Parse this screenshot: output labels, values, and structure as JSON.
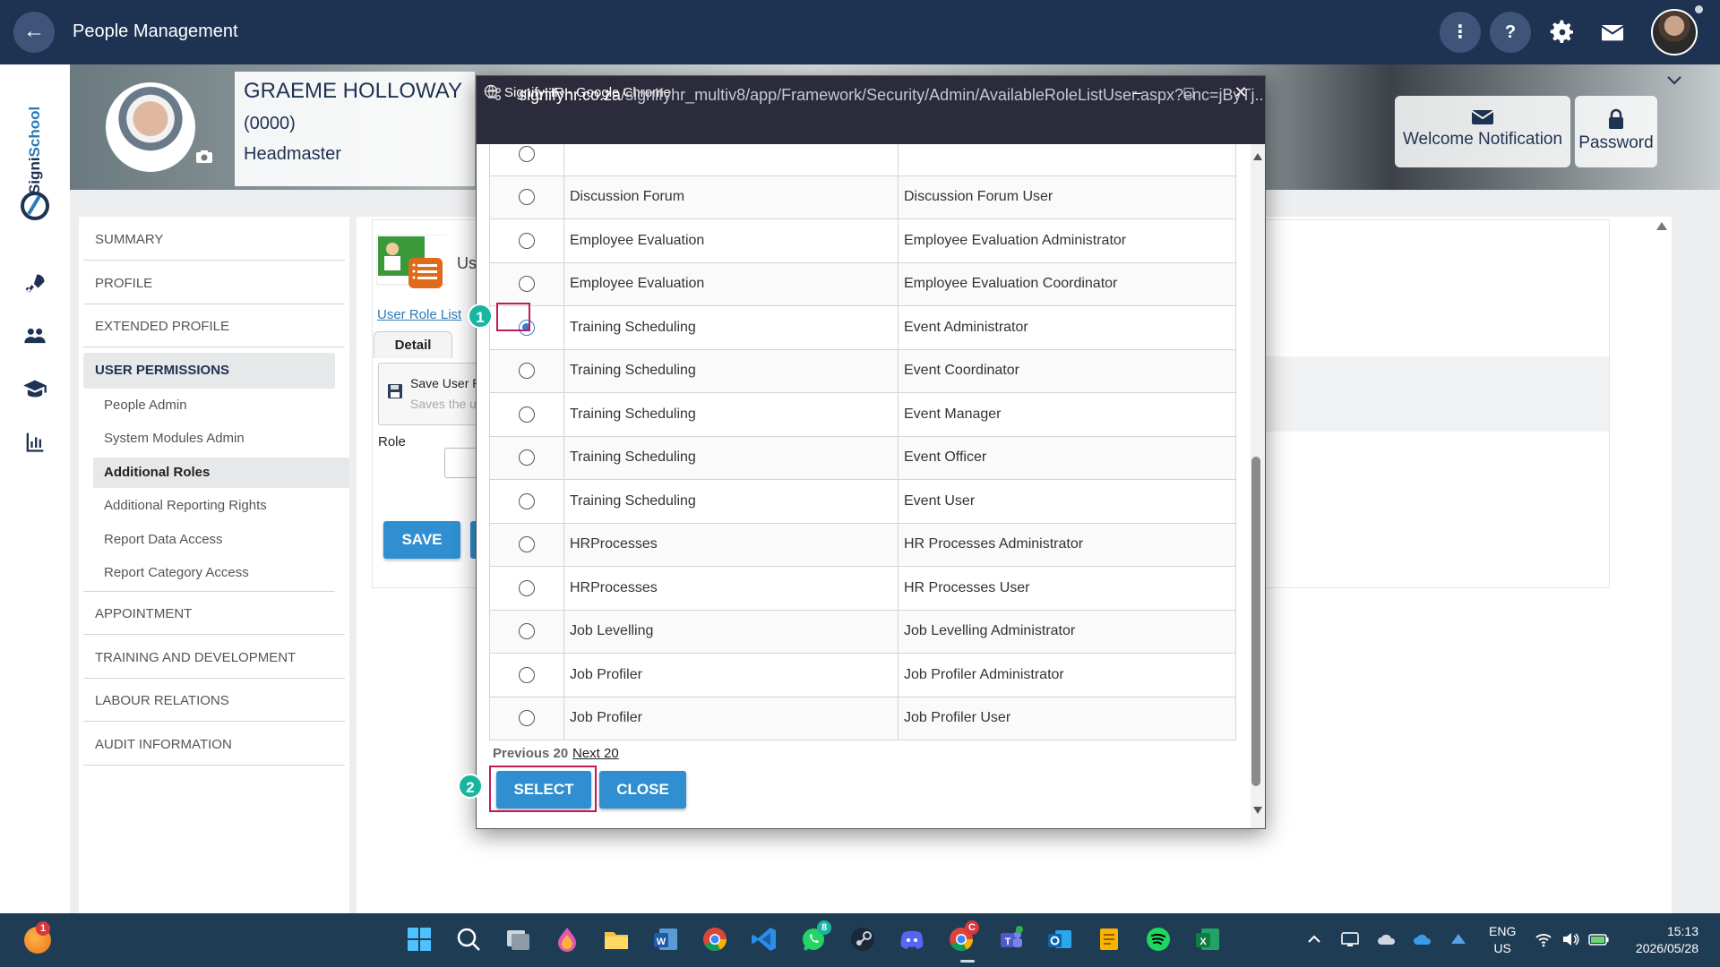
{
  "app": {
    "title": "People Management"
  },
  "topbar_icons": [
    "arrow-left-icon",
    "more-vertical-icon",
    "help-icon",
    "gear-icon",
    "mail-icon"
  ],
  "employee": {
    "name": "GRAEME HOLLOWAY",
    "code": "(0000)",
    "title": "Headmaster"
  },
  "banner_buttons": [
    {
      "label": "Welcome Notification",
      "icon": "envelope-icon"
    },
    {
      "label": "Password",
      "icon": "lock-icon"
    }
  ],
  "brand": {
    "logo_text": "SigniSchool"
  },
  "nav": {
    "summary": "SUMMARY",
    "profile": "PROFILE",
    "extended_profile": "EXTENDED PROFILE",
    "user_permissions": "USER PERMISSIONS",
    "sub_items": [
      "People Admin",
      "System Modules Admin",
      "Additional Roles",
      "Additional Reporting Rights",
      "Report Data Access",
      "Report Category Access"
    ],
    "appointment": "APPOINTMENT",
    "training": "TRAINING AND DEVELOPMENT",
    "labour": "LABOUR RELATIONS",
    "audit": "AUDIT INFORMATION"
  },
  "main": {
    "module_title": "Us",
    "role_list_link": "User Role List",
    "detail_tab": "Detail",
    "save_box_title": "Save User R",
    "save_box_subtitle": "Saves the u",
    "role_label": "Role",
    "save_button": "SAVE"
  },
  "popup": {
    "window_title": "SignifyHR - Google Chrome",
    "url_host": "signifyhr.co.za",
    "url_path": "/signifyhr_multiv8/app/Framework/Security/Admin/AvailableRoleListUser.aspx?enc=jByTj...",
    "rows": [
      {
        "module": "",
        "role": "",
        "checked": false
      },
      {
        "module": "Discussion Forum",
        "role": "Discussion Forum User",
        "checked": false
      },
      {
        "module": "Employee Evaluation",
        "role": "Employee Evaluation Administrator",
        "checked": false
      },
      {
        "module": "Employee Evaluation",
        "role": "Employee Evaluation Coordinator",
        "checked": false
      },
      {
        "module": "Training Scheduling",
        "role": "Event Administrator",
        "checked": true
      },
      {
        "module": "Training Scheduling",
        "role": "Event Coordinator",
        "checked": false
      },
      {
        "module": "Training Scheduling",
        "role": "Event Manager",
        "checked": false
      },
      {
        "module": "Training Scheduling",
        "role": "Event Officer",
        "checked": false
      },
      {
        "module": "Training Scheduling",
        "role": "Event User",
        "checked": false
      },
      {
        "module": "HRProcesses",
        "role": "HR Processes Administrator",
        "checked": false
      },
      {
        "module": "HRProcesses",
        "role": "HR Processes User",
        "checked": false
      },
      {
        "module": "Job Levelling",
        "role": "Job Levelling Administrator",
        "checked": false
      },
      {
        "module": "Job Profiler",
        "role": "Job Profiler Administrator",
        "checked": false
      },
      {
        "module": "Job Profiler",
        "role": "Job Profiler User",
        "checked": false
      }
    ],
    "prev_label": "Previous 20",
    "next_label": "Next 20",
    "select_button": "SELECT",
    "close_button": "CLOSE"
  },
  "annotations": {
    "step1": "1",
    "step2": "2"
  },
  "taskbar": {
    "apps": [
      "start-icon",
      "search-icon",
      "task-view-icon",
      "paint-icon",
      "file-explorer-icon",
      "word-icon",
      "chrome-icon",
      "vscode-icon",
      "whatsapp-icon",
      "steam-icon",
      "discord-icon",
      "chrome-profile-icon",
      "teams-icon",
      "outlook-icon",
      "notes-icon",
      "spotify-icon",
      "excel-icon"
    ],
    "badges": {
      "weather": "1",
      "whatsapp": "8",
      "chrome_profile": "C"
    },
    "lang_top": "ENG",
    "lang_bottom": "US",
    "time": "15:13",
    "date": "2026/05/28"
  },
  "colors": {
    "topbar": "#1e3252",
    "primary_button": "#2f8fd0",
    "annotation": "#c2185b",
    "badge": "#19b5a0",
    "taskbar": "#1f3c55"
  }
}
